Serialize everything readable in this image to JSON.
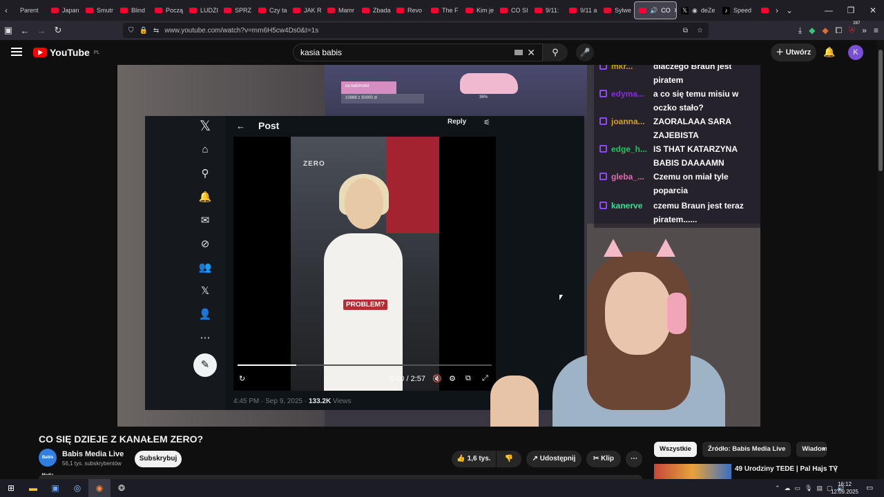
{
  "browser": {
    "tabs": [
      {
        "label": "Parent",
        "icon": "x"
      },
      {
        "label": "Japan",
        "icon": "yt"
      },
      {
        "label": "Smutr",
        "icon": "yt"
      },
      {
        "label": "Blind",
        "icon": "yt"
      },
      {
        "label": "Począ",
        "icon": "yt"
      },
      {
        "label": "LUDZI",
        "icon": "yt"
      },
      {
        "label": "SPRZ",
        "icon": "yt"
      },
      {
        "label": "Czy ta",
        "icon": "yt"
      },
      {
        "label": "JAK R",
        "icon": "yt"
      },
      {
        "label": "Mamr",
        "icon": "yt"
      },
      {
        "label": "Zbada",
        "icon": "yt"
      },
      {
        "label": "Revo",
        "icon": "yt"
      },
      {
        "label": "The F",
        "icon": "yt"
      },
      {
        "label": "Kim je",
        "icon": "yt"
      },
      {
        "label": "CO SI",
        "icon": "yt"
      },
      {
        "label": "9/11:",
        "icon": "yt"
      },
      {
        "label": "9/11 a",
        "icon": "yt"
      },
      {
        "label": "Sylwe",
        "icon": "yt"
      }
    ],
    "active_tab": "CO",
    "extra_tabs": [
      "deZe",
      "Speed"
    ],
    "url": "www.youtube.com/watch?v=mm6H5cw4Ds0&t=1s",
    "ext_badge": "287"
  },
  "yt": {
    "logo": "YouTube",
    "region": "PL",
    "search_value": "kasia babis",
    "create_label": "Utwórz",
    "avatar_letter": "K"
  },
  "video": {
    "stream_bar_label": "na babimobil",
    "stream_bar_amount": "10868 z 30000 zł",
    "stream_bar_pct": "36%",
    "stream_bar_fraction": 0.36,
    "x_post": {
      "header": "Post",
      "reply": "Reply",
      "watermark": "ZERO",
      "caption": "PROBLEM?",
      "time": "0:40 / 2:57",
      "progress_fraction": 0.23,
      "meta_time": "4:45 PM · Sep 9, 2025 ·",
      "views_count": "133.2K",
      "views_label": "Views"
    },
    "chat": [
      {
        "name": "mkr...",
        "text": "dlaczego Braun jest piratem",
        "color": "#c9a000"
      },
      {
        "name": "edyma...",
        "text": "a co się temu misiu w oczko stało?",
        "color": "#8a2be2"
      },
      {
        "name": "joanna...",
        "text": "ZAORALAAA SARA ZAJEBISTA",
        "color": "#d4a017"
      },
      {
        "name": "edge_h...",
        "text": "IS THAT KATARZYNA BABIS DAAAAMN",
        "color": "#22c55e"
      },
      {
        "name": "gleba_...",
        "text": "Czemu on miał tyle poparcia",
        "color": "#d96fb0"
      },
      {
        "name": "kanerve",
        "text": "czemu Braun jest teraz piratem......",
        "color": "#3ddc97"
      }
    ]
  },
  "below": {
    "title": "CO SIĘ DZIEJE Z KANAŁEM ZERO?",
    "channel": "Babis Media Live",
    "subscribers": "56,1 tys. subskrybentów",
    "avatar_text": "Babis Media",
    "subscribe": "Subskrybuj",
    "likes": "1,6 tys.",
    "share": "Udostępnij",
    "clip": "Klip"
  },
  "sidebar": {
    "chips": [
      "Wszystkie",
      "Źródło: Babis Media Live",
      "Wiadom"
    ],
    "rec_title": "49 Urodziny TEDE | Pal Hajs TV"
  },
  "taskbar": {
    "time": "16:12",
    "date": "12.09.2025"
  }
}
